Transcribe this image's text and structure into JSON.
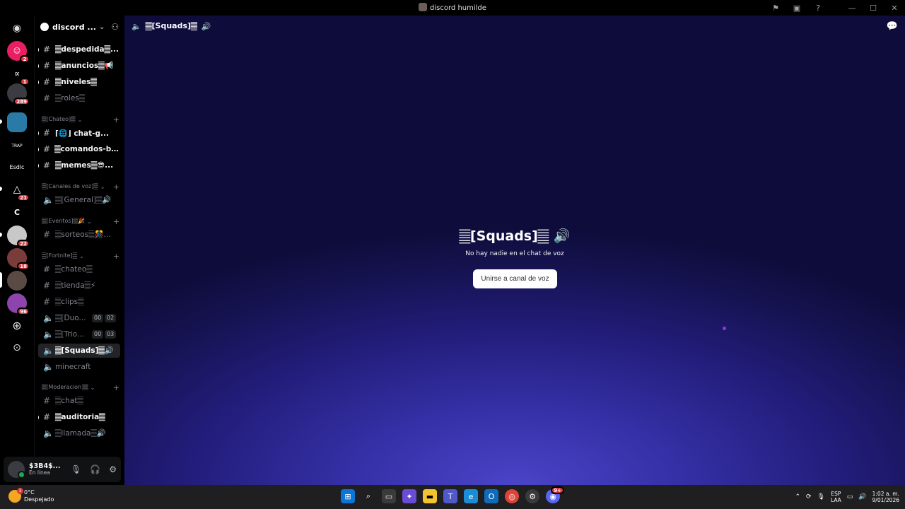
{
  "window": {
    "title": "discord humilde",
    "controls": [
      "inbox-icon",
      "window-icon",
      "help-icon",
      "minimize",
      "maximize",
      "close"
    ]
  },
  "servers": [
    {
      "name": "home",
      "icon": "discord-icon"
    },
    {
      "name": "dm-1",
      "badge": "2",
      "color": "#e91e63"
    },
    {
      "name": "dm-2",
      "badge": "1",
      "color": "#2b2d31"
    },
    {
      "name": "dm-3",
      "badge": "289",
      "color": "#3a3c42"
    },
    {
      "name": "server-a",
      "color": "#2a7aa8"
    },
    {
      "name": "server-trap",
      "label": "TRAP",
      "color": "#000"
    },
    {
      "name": "server-esdlc",
      "label": "Esdlc",
      "color": "#000"
    },
    {
      "name": "server-delta",
      "badge": "21",
      "color": "#000"
    },
    {
      "name": "server-c",
      "label": "C",
      "color": "#000"
    },
    {
      "name": "server-b",
      "badge": "22",
      "color": "#c8c8c8"
    },
    {
      "name": "server-d",
      "badge": "18",
      "color": "#7a3b3b"
    },
    {
      "name": "server-e",
      "color": "#5a4a44"
    },
    {
      "name": "server-f",
      "badge": "96",
      "color": "#8e44ad"
    }
  ],
  "guild": {
    "name": "discord ..."
  },
  "channels": {
    "c1": "𝄛despedida𝄛...",
    "c2": "𝄛anuncios𝄛📢",
    "c3": "𝄛niveles𝄛",
    "c4": "𝄛roles𝄛",
    "cat_chateo": "𝄛[Chateo]𝄛",
    "c5": "⌈🌐⌋ chat-g...",
    "c6": "𝄛comandos-bo...",
    "c7": "𝄛memes𝄛😎...",
    "cat_voz": "𝄛[Canales de voz]𝄛",
    "c8": "𝄛[General]𝄛🔊",
    "cat_eventos": "𝄛[Eventos]𝄛🎉",
    "c9": "𝄛sorteos𝄛🎊...",
    "cat_fortnite": "𝄛[Fortnite]𝄛",
    "c10": "𝄛chateo𝄛",
    "c11": "𝄛tienda𝄛⚡",
    "c12": "𝄛clips𝄛",
    "c13": "𝄛[Duo...",
    "c13_a": "00",
    "c13_b": "02",
    "c14": "𝄛[Trio...",
    "c14_a": "00",
    "c14_b": "03",
    "c15": "𝄛[Squads]𝄛🔊",
    "c16": "minecraft",
    "cat_moderacion": "𝄛[Moderacion]𝄛",
    "c17": "𝄛chat𝄛",
    "c18": "𝄛auditoria𝄛",
    "c19": "𝄛llamada𝄛🔊"
  },
  "user": {
    "name": "$3B4$...",
    "status": "En línea"
  },
  "voice": {
    "header": "𝄛[Squads]𝄛",
    "title": "𝄛[Squads]𝄛",
    "subtitle": "No hay nadie en el chat de voz",
    "join_label": "Unirse a canal de voz"
  },
  "taskbar": {
    "weather_temp": "0°C",
    "weather_desc": "Despejado",
    "weather_badge": "3",
    "discord_badge": "9+",
    "lang_1": "ESP",
    "lang_2": "LAA",
    "time": "1:02 a. m.",
    "date": "9/01/2026"
  },
  "colors": {
    "accent_voice": "#3530a6",
    "badge_red": "#da373c",
    "online_green": "#23a559"
  }
}
